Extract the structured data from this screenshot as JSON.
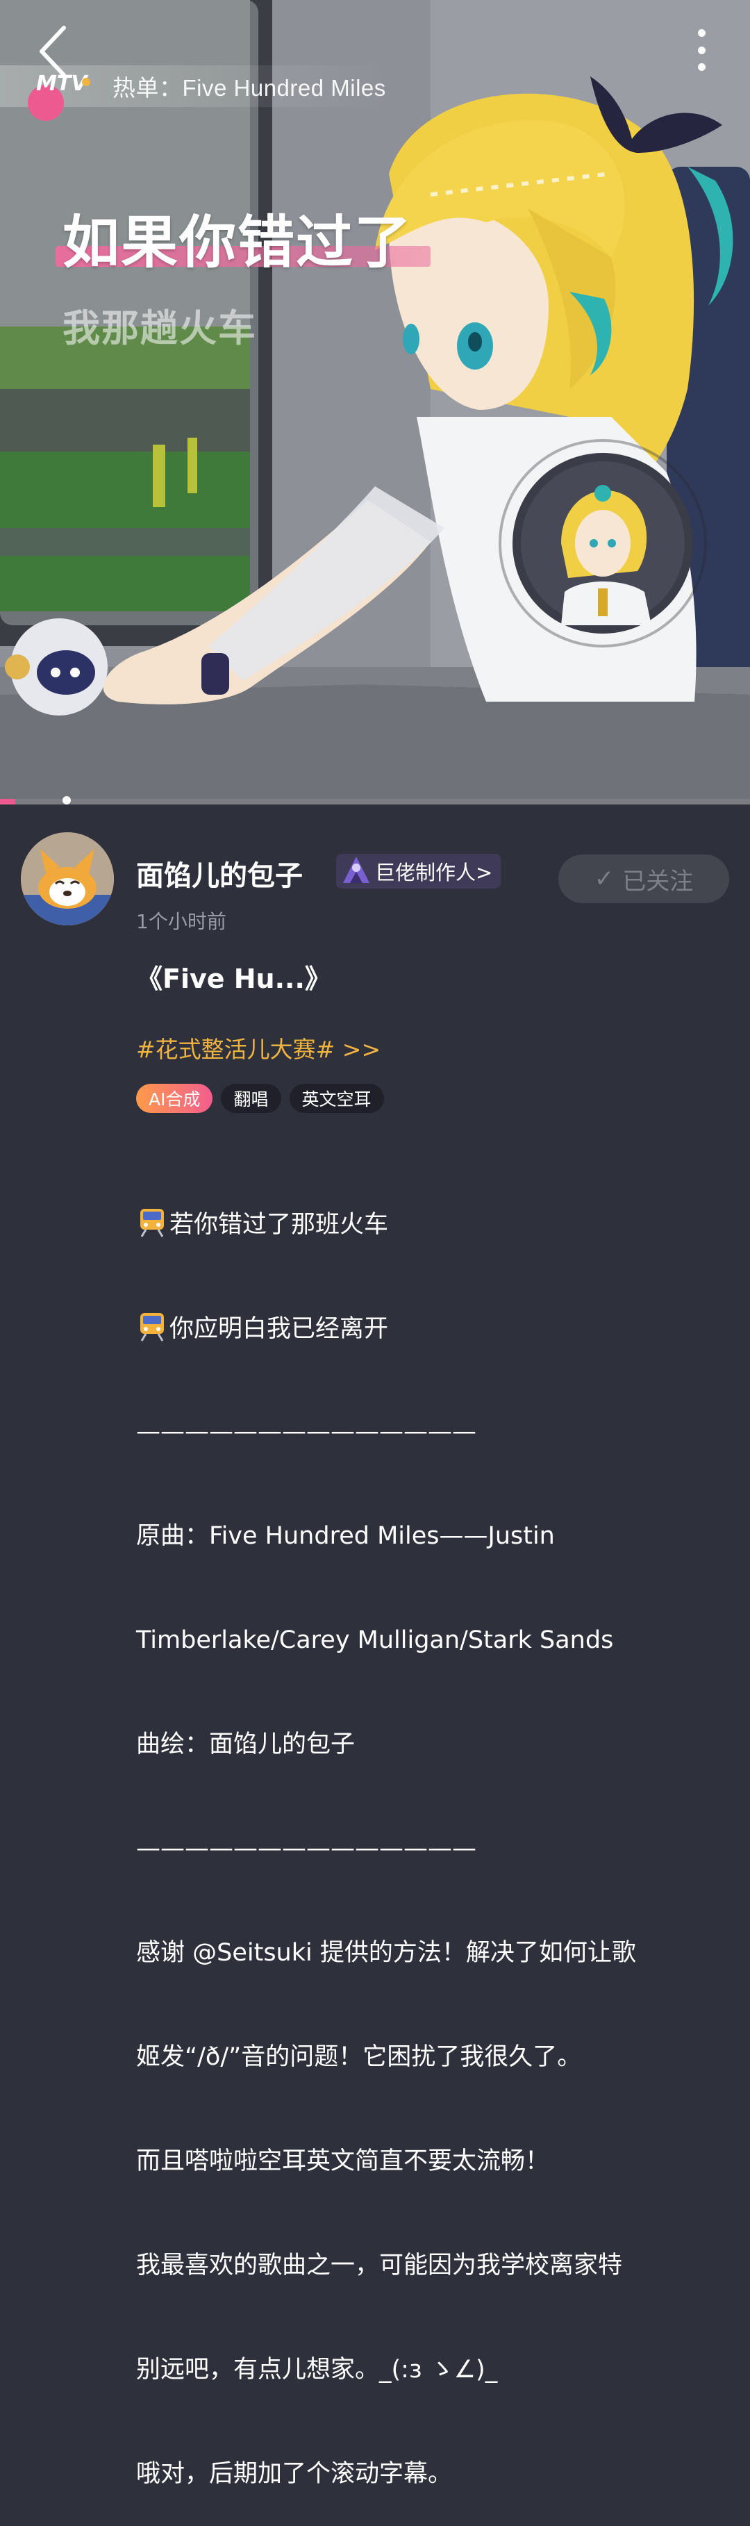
{
  "header": {
    "playlist_label": "热单：Five Hundred Miles",
    "logo_text": "MTV"
  },
  "lyrics": {
    "current": "如果你错过了",
    "next": "我那趟火车"
  },
  "progress": {
    "fraction": 0.02
  },
  "author": {
    "name": "面馅儿的包子",
    "badge": "巨佬制作人>",
    "time": "1个小时前",
    "follow_label": "已关注",
    "follow_check": "✓"
  },
  "post": {
    "title": "《Five Hu...》",
    "topic": "#花式整活儿大赛# >>",
    "tags": [
      "AI合成",
      "翻唱",
      "英文空耳"
    ],
    "lines": [
      {
        "icon": "train-icon",
        "text": "若你错过了那班火车"
      },
      {
        "icon": "train-icon",
        "text": "你应明白我已经离开"
      },
      {
        "text": "——————————————"
      },
      {
        "text": "原曲：Five Hundred Miles——Justin"
      },
      {
        "text": "Timberlake/Carey Mulligan/Stark Sands"
      },
      {
        "text": "曲绘：面馅儿的包子"
      },
      {
        "text": "——————————————"
      },
      {
        "text": "感谢 @Seitsuki 提供的方法！解决了如何让歌"
      },
      {
        "text": "姬发“/ð/”音的问题！它困扰了我很久了。"
      },
      {
        "text": "而且嗒啦啦空耳英文简直不要太流畅！"
      },
      {
        "text": "我最喜欢的歌曲之一，可能因为我学校离家特"
      },
      {
        "text": "别远吧，有点儿想家。_(:з ゝ∠)_"
      },
      {
        "text": "哦对，后期加了个滚动字幕。"
      }
    ]
  },
  "colors": {
    "accent_pink": "#ec5a8f",
    "topic_orange": "#f1b33f",
    "background": "#2e303c"
  }
}
